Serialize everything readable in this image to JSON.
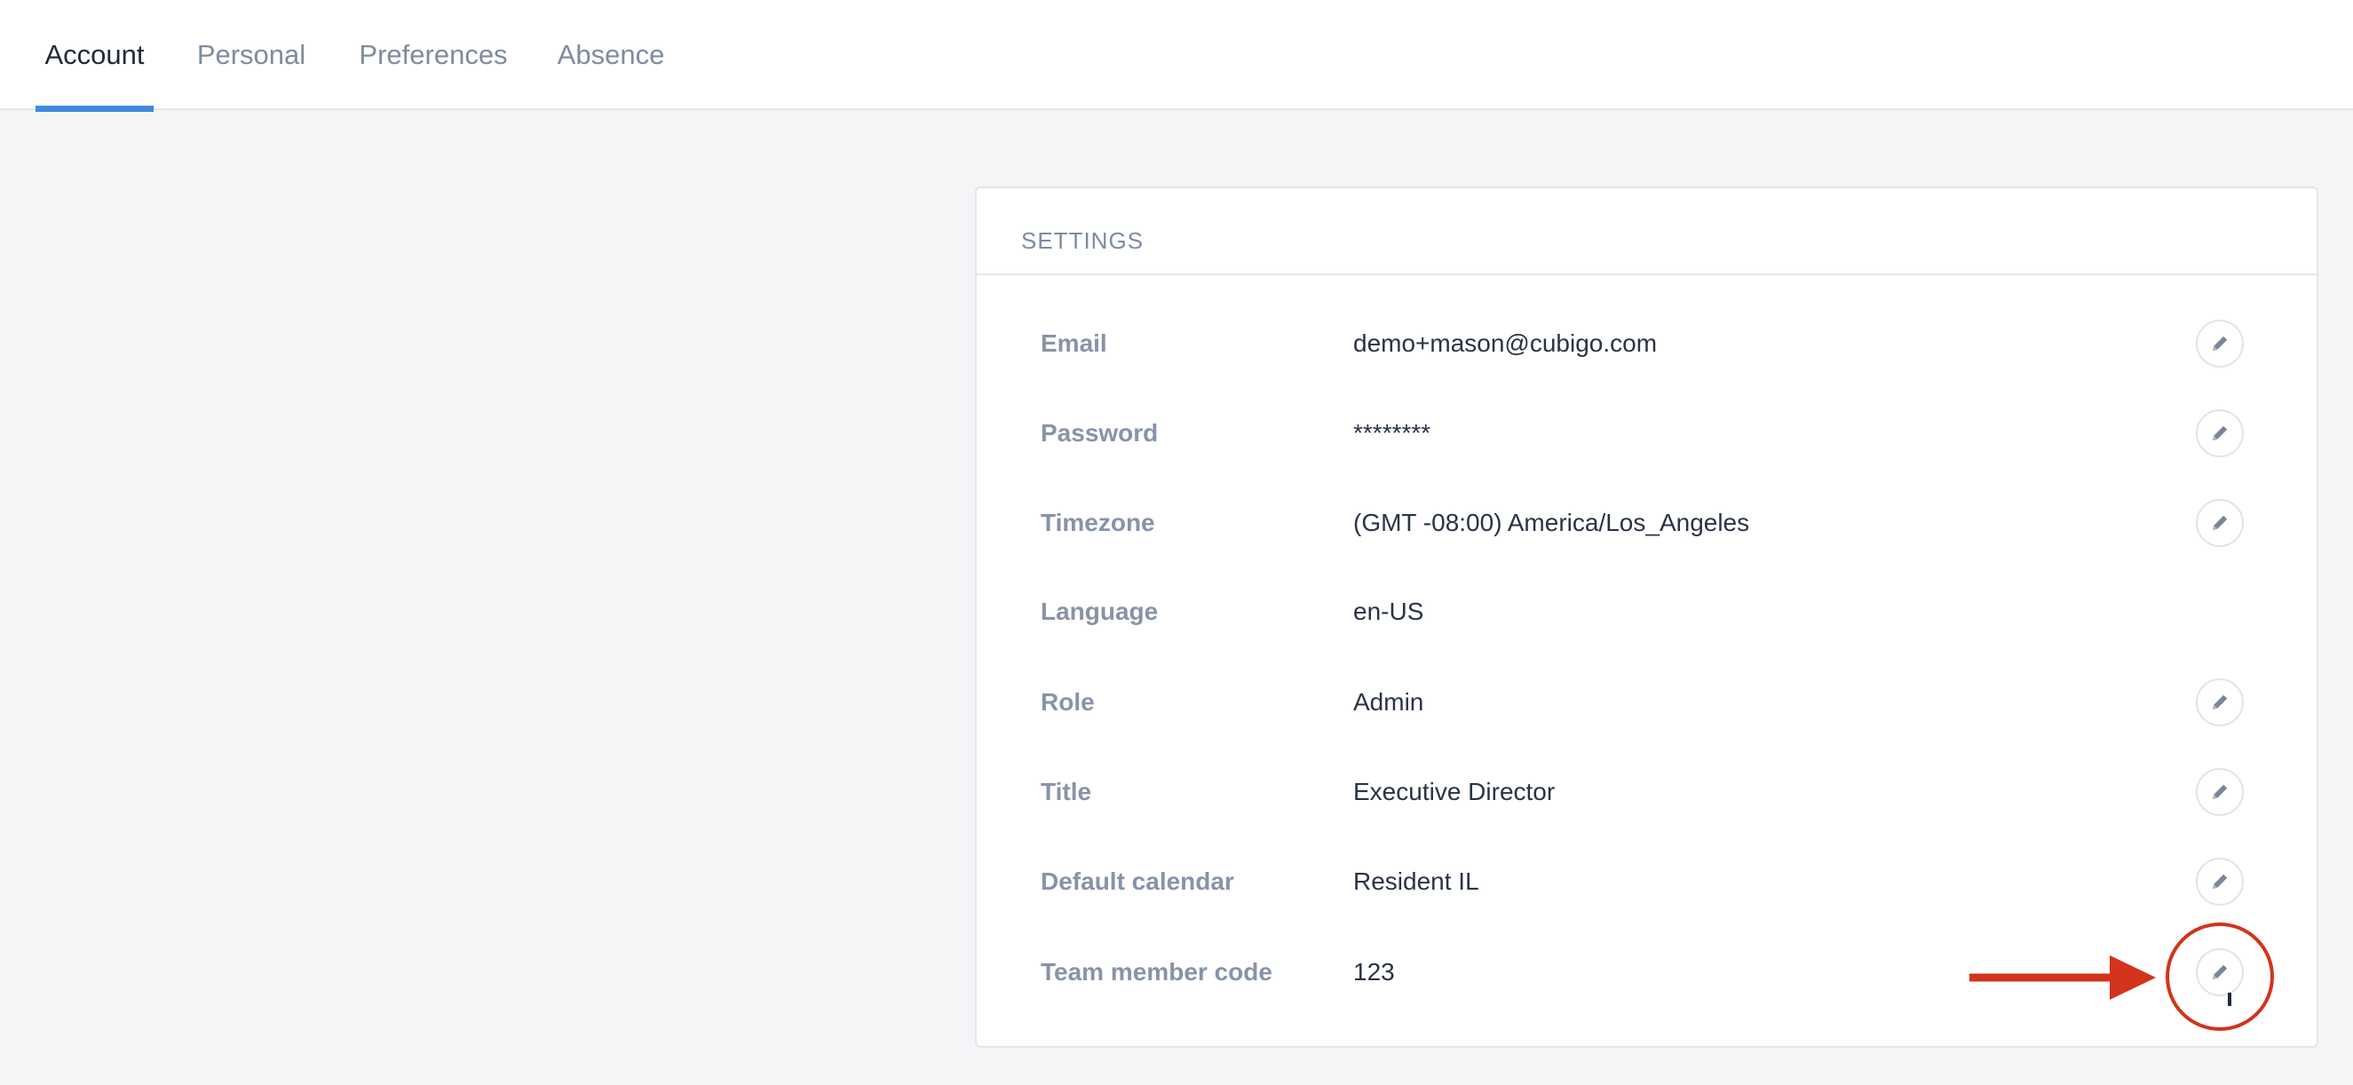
{
  "tabs": [
    {
      "label": "Account",
      "active": true
    },
    {
      "label": "Personal",
      "active": false
    },
    {
      "label": "Preferences",
      "active": false
    },
    {
      "label": "Absence",
      "active": false
    }
  ],
  "settings": {
    "title": "SETTINGS",
    "rows": [
      {
        "label": "Email",
        "value": "demo+mason@cubigo.com",
        "editable": true
      },
      {
        "label": "Password",
        "value": "********",
        "editable": true
      },
      {
        "label": "Timezone",
        "value": "(GMT -08:00) America/Los_Angeles",
        "editable": true
      },
      {
        "label": "Language",
        "value": "en-US",
        "editable": false
      },
      {
        "label": "Role",
        "value": "Admin",
        "editable": true
      },
      {
        "label": "Title",
        "value": "Executive Director",
        "editable": true
      },
      {
        "label": "Default calendar",
        "value": "Resident IL",
        "editable": true
      },
      {
        "label": "Team member code",
        "value": "123",
        "editable": true
      }
    ]
  },
  "icons": {
    "edit": "pencil-icon",
    "annotation": "red-arrow-and-circle"
  },
  "colors": {
    "accent": "#3f8ae0",
    "annotation": "#d2341c",
    "active_tab_text": "#1f2a3c",
    "inactive_tab_text": "#7e8ba1",
    "page_background": "#f4f5f7"
  }
}
